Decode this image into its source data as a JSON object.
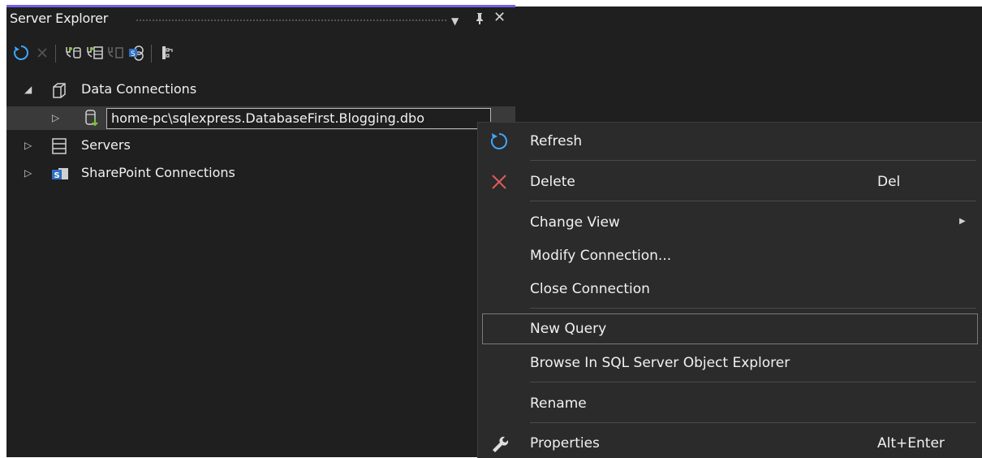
{
  "window": {
    "title": "Server Explorer",
    "dropdown_icon": "dropdown-arrow-icon",
    "pin_icon": "pin-icon",
    "close_icon": "close-icon"
  },
  "toolbar": {
    "tools": [
      "refresh-icon",
      "stop-icon",
      "connect-to-database-icon",
      "connect-to-server-icon",
      "add-sharepoint-icon",
      "azure-icon",
      "properties-icon"
    ]
  },
  "tree": {
    "data_connections": "Data Connections",
    "connection_edit_value": "home-pc\\sqlexpress.DatabaseFirst.Blogging.dbo",
    "servers": "Servers",
    "sharepoint": "SharePoint Connections"
  },
  "context_menu": {
    "refresh": "Refresh",
    "delete": "Delete",
    "delete_shortcut": "Del",
    "change_view": "Change View",
    "modify_connection": "Modify Connection...",
    "close_connection": "Close Connection",
    "new_query": "New Query",
    "browse": "Browse In SQL Server Object Explorer",
    "rename": "Rename",
    "properties": "Properties",
    "properties_shortcut": "Alt+Enter"
  },
  "colors": {
    "panel_bg": "#1f1f1f",
    "menu_bg": "#2b2b2b",
    "accent": "#7160e8",
    "refresh_blue": "#3ea8ff",
    "delete_red": "#e05a5a"
  }
}
